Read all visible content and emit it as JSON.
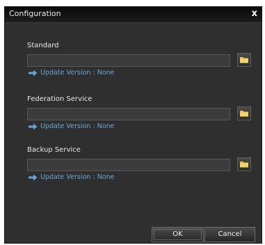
{
  "window": {
    "title": "Configuration",
    "close_label": "x"
  },
  "sections": [
    {
      "label": "Standard",
      "path_value": "",
      "update_text": "Update Version : None"
    },
    {
      "label": "Federation Service",
      "path_value": "",
      "update_text": "Update Version : None"
    },
    {
      "label": "Backup Service",
      "path_value": "",
      "update_text": "Update Version : None"
    }
  ],
  "buttons": {
    "ok_label": "OK",
    "cancel_label": "Cancel"
  },
  "colors": {
    "dialog_bg": "#2f2f2f",
    "titlebar_bg": "#141414",
    "update_text": "#6aa6d8",
    "folder_icon": "#f2c14a"
  },
  "icons": {
    "folder": "folder-icon",
    "arrow": "arrow-right-icon",
    "close": "close-icon"
  }
}
